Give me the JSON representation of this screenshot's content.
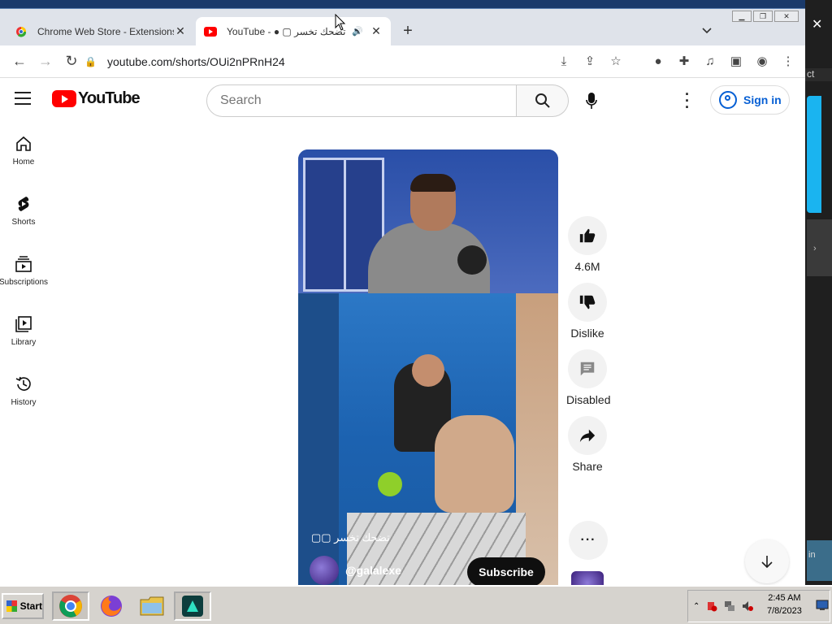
{
  "browser": {
    "tabs": [
      {
        "title": "Chrome Web Store - Extensions",
        "active": false
      },
      {
        "title": "YouTube - ● ▢ تضحك تخسر",
        "active": true
      }
    ],
    "url": "youtube.com/shorts/OUi2nPRnH24"
  },
  "youtube": {
    "logo_text": "YouTube",
    "search_placeholder": "Search",
    "sign_in": "Sign in",
    "nav": [
      "Home",
      "Shorts",
      "Subscriptions",
      "Library",
      "History"
    ]
  },
  "short": {
    "caption": "تضحك تخسر ▢▢",
    "channel": "@galalexe",
    "subscribe": "Subscribe",
    "likes": "4.6M",
    "dislike": "Dislike",
    "comments": "Disabled",
    "share": "Share"
  },
  "desktop": {
    "edge_text_1": "ct",
    "edge_text_2": "in"
  },
  "taskbar": {
    "start": "Start",
    "time": "2:45 AM",
    "date": "7/8/2023"
  }
}
